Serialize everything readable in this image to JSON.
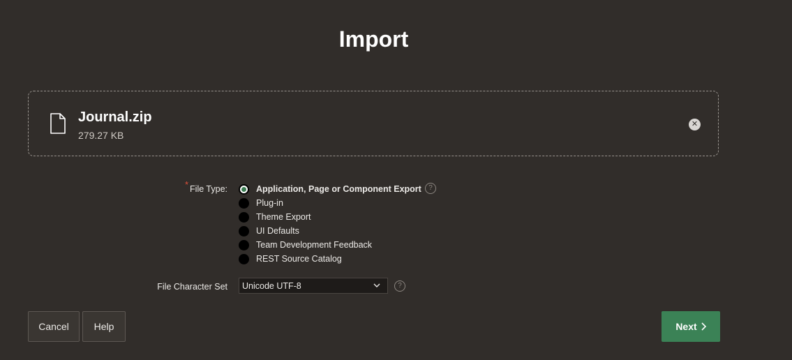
{
  "page": {
    "title": "Import"
  },
  "file": {
    "name": "Journal.zip",
    "size": "279.27 KB",
    "remove_icon": "close-icon"
  },
  "file_type": {
    "label": "File Type:",
    "required_mark": "*",
    "options": [
      {
        "label": "Application, Page or Component Export",
        "selected": true
      },
      {
        "label": "Plug-in",
        "selected": false
      },
      {
        "label": "Theme Export",
        "selected": false
      },
      {
        "label": "UI Defaults",
        "selected": false
      },
      {
        "label": "Team Development Feedback",
        "selected": false
      },
      {
        "label": "REST Source Catalog",
        "selected": false
      }
    ],
    "help_icon": "?"
  },
  "charset": {
    "label": "File Character Set",
    "value": "Unicode UTF-8",
    "help_icon": "?"
  },
  "buttons": {
    "cancel": "Cancel",
    "help": "Help",
    "next": "Next"
  },
  "colors": {
    "background": "#312d2a",
    "primary_button": "#3b8256",
    "required": "#e0503a"
  }
}
